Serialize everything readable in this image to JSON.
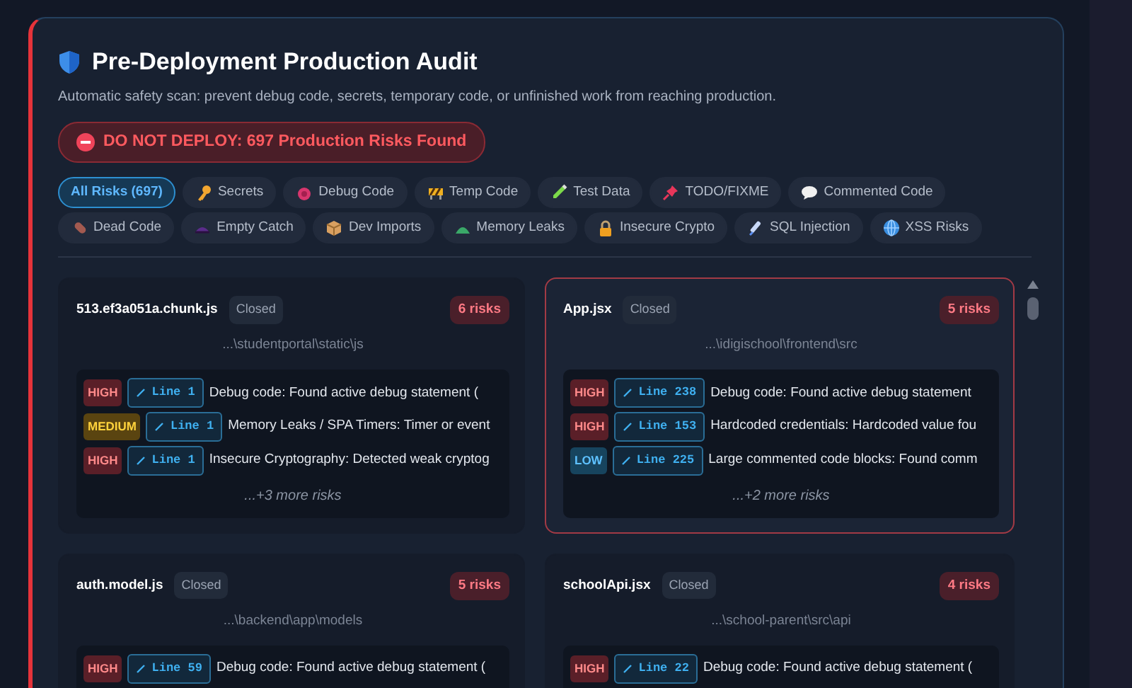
{
  "header": {
    "title": "Pre-Deployment Production Audit",
    "subtitle": "Automatic safety scan: prevent debug code, secrets, temporary code, or unfinished work from reaching production."
  },
  "alert": {
    "text": "DO NOT DEPLOY: 697 Production Risks Found"
  },
  "filters": [
    {
      "label": "All Risks (697)",
      "selected": true
    },
    {
      "label": "Secrets",
      "selected": false,
      "kind": "key"
    },
    {
      "label": "Debug Code",
      "selected": false,
      "kind": "bug"
    },
    {
      "label": "Temp Code",
      "selected": false,
      "kind": "barrier"
    },
    {
      "label": "Test Data",
      "selected": false,
      "kind": "tube"
    },
    {
      "label": "TODO/FIXME",
      "selected": false,
      "kind": "pin"
    },
    {
      "label": "Commented Code",
      "selected": false,
      "kind": "bubble"
    },
    {
      "label": "Dead Code",
      "selected": false,
      "kind": "pill"
    },
    {
      "label": "Empty Catch",
      "selected": false,
      "kind": "lens"
    },
    {
      "label": "Dev Imports",
      "selected": false,
      "kind": "box"
    },
    {
      "label": "Memory Leaks",
      "selected": false,
      "kind": "dome"
    },
    {
      "label": "Insecure Crypto",
      "selected": false,
      "kind": "lock"
    },
    {
      "label": "SQL Injection",
      "selected": false,
      "kind": "syringe"
    },
    {
      "label": "XSS Risks",
      "selected": false,
      "kind": "globe"
    }
  ],
  "files": [
    {
      "name": "513.ef3a051a.chunk.js",
      "status": "Closed",
      "risk_count": "6 risks",
      "path": "...\\studentportal\\static\\js",
      "selected": false,
      "issues": [
        {
          "severity": "HIGH",
          "kind": "high",
          "line": "Line 1",
          "text": "Debug code: Found active debug statement ("
        },
        {
          "severity": "MEDIUM",
          "kind": "medium",
          "line": "Line 1",
          "text": "Memory Leaks / SPA Timers: Timer or event"
        },
        {
          "severity": "HIGH",
          "kind": "high",
          "line": "Line 1",
          "text": "Insecure Cryptography: Detected weak cryptog"
        }
      ],
      "more": "...+3 more risks"
    },
    {
      "name": "App.jsx",
      "status": "Closed",
      "risk_count": "5 risks",
      "path": "...\\idigischool\\frontend\\src",
      "selected": true,
      "issues": [
        {
          "severity": "HIGH",
          "kind": "high",
          "line": "Line 238",
          "text": "Debug code: Found active debug statement"
        },
        {
          "severity": "HIGH",
          "kind": "high",
          "line": "Line 153",
          "text": "Hardcoded credentials: Hardcoded value fou"
        },
        {
          "severity": "LOW",
          "kind": "low",
          "line": "Line 225",
          "text": "Large commented code blocks: Found comm"
        }
      ],
      "more": "...+2 more risks"
    },
    {
      "name": "auth.model.js",
      "status": "Closed",
      "risk_count": "5 risks",
      "path": "...\\backend\\app\\models",
      "selected": false,
      "issues": [
        {
          "severity": "HIGH",
          "kind": "high",
          "line": "Line 59",
          "text": "Debug code: Found active debug statement ("
        }
      ]
    },
    {
      "name": "schoolApi.jsx",
      "status": "Closed",
      "risk_count": "4 risks",
      "path": "...\\school-parent\\src\\api",
      "selected": false,
      "issues": [
        {
          "severity": "HIGH",
          "kind": "high",
          "line": "Line 22",
          "text": "Debug code: Found active debug statement ("
        }
      ]
    }
  ]
}
